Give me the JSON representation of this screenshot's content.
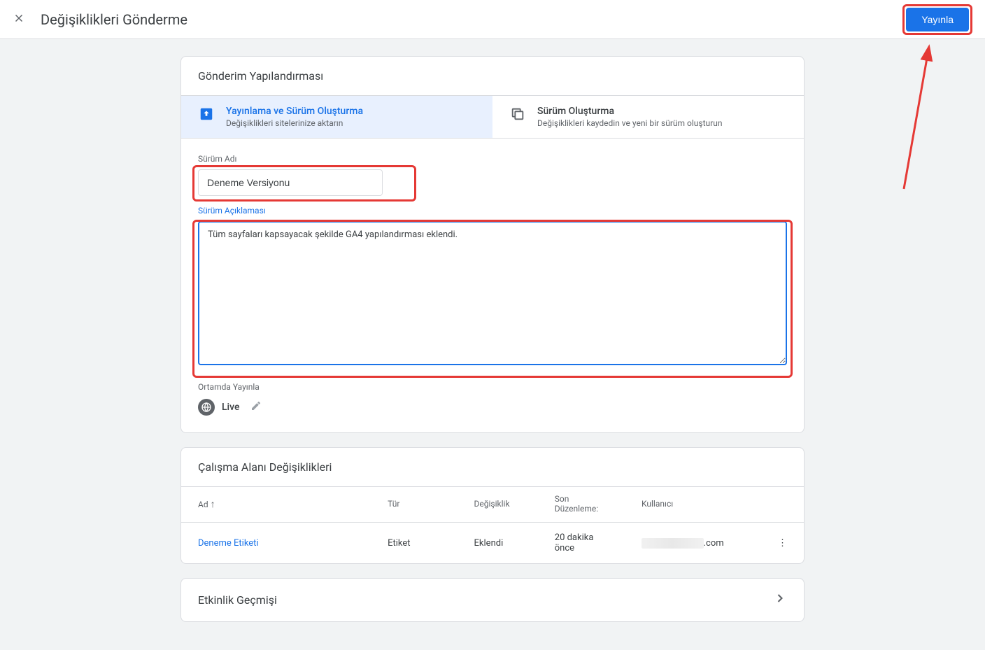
{
  "header": {
    "title": "Değişiklikleri Gönderme",
    "publish_button": "Yayınla"
  },
  "config_card": {
    "title": "Gönderim Yapılandırması",
    "tabs": [
      {
        "label": "Yayınlama ve Sürüm Oluşturma",
        "desc": "Değişiklikleri sitelerinize aktarın"
      },
      {
        "label": "Sürüm Oluşturma",
        "desc": "Değişiklikleri kaydedin ve yeni bir sürüm oluşturun"
      }
    ],
    "version_name_label": "Sürüm Adı",
    "version_name_value": "Deneme Versiyonu",
    "version_desc_label": "Sürüm Açıklaması",
    "version_desc_value": "Tüm sayfaları kapsayacak şekilde GA4 yapılandırması eklendi.",
    "env_label": "Ortamda Yayınla",
    "env_name": "Live"
  },
  "changes": {
    "title": "Çalışma Alanı Değişiklikleri",
    "columns": {
      "name": "Ad",
      "type": "Tür",
      "change": "Değişiklik",
      "last_edit": "Son Düzenleme:",
      "user": "Kullanıcı"
    },
    "rows": [
      {
        "name": "Deneme Etiketi",
        "type": "Etiket",
        "change": "Eklendi",
        "last_edit": "20 dakika önce",
        "user_suffix": ".com"
      }
    ]
  },
  "activity": {
    "title": "Etkinlik Geçmişi"
  }
}
